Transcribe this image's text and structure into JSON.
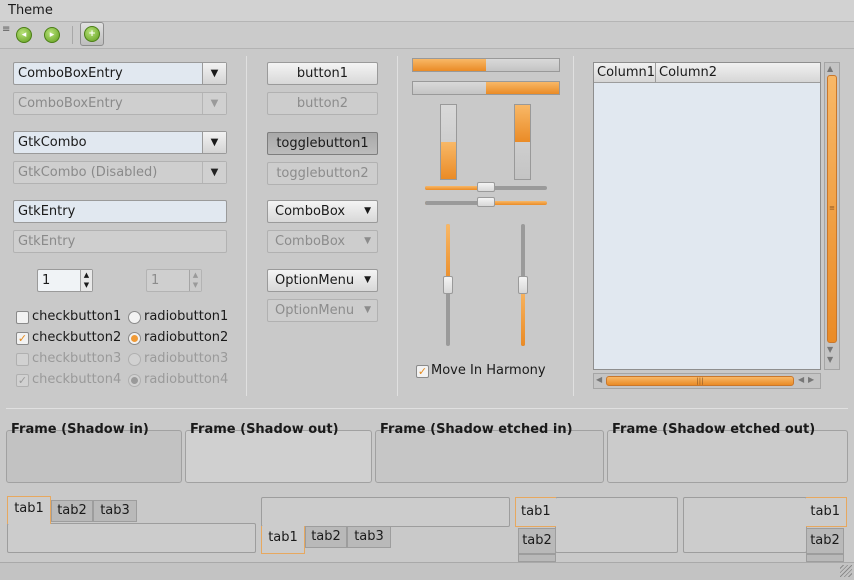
{
  "menubar": {
    "theme": "Theme"
  },
  "toolbar": {
    "first_icon": "go-first-icon",
    "last_icon": "go-last-icon",
    "add_icon": "add-icon"
  },
  "col1": {
    "combo_entry": "ComboBoxEntry",
    "combo_entry_disabled": "ComboBoxEntry",
    "gtk_combo": "GtkCombo",
    "gtk_combo_disabled": "GtkCombo (Disabled)",
    "entry": "GtkEntry",
    "entry_disabled_placeholder": "GtkEntry",
    "spin1": "1",
    "spin2": "1",
    "check1": "checkbutton1",
    "check2": "checkbutton2",
    "check3": "checkbutton3",
    "check4": "checkbutton4",
    "radio1": "radiobutton1",
    "radio2": "radiobutton2",
    "radio3": "radiobutton3",
    "radio4": "radiobutton4"
  },
  "col2": {
    "button1": "button1",
    "button2": "button2",
    "toggle1": "togglebutton1",
    "toggle2": "togglebutton2",
    "combobox": "ComboBox",
    "combobox_disabled": "ComboBox",
    "optionmenu": "OptionMenu",
    "optionmenu_disabled": "OptionMenu"
  },
  "col3": {
    "hbar1_fraction": 0.5,
    "hbar2_fraction": 0.5,
    "vbar1_fraction": 0.5,
    "vbar2_fraction": 0.5,
    "hscale1_value": 0.5,
    "hscale2_value": 0.5,
    "vscale1_value": 0.5,
    "vscale2_value": 0.5,
    "harmony": "Move In Harmony"
  },
  "tree": {
    "columns": [
      "Column1",
      "Column2"
    ]
  },
  "frames": {
    "shadow_in": "Frame (Shadow in)",
    "shadow_out": "Frame (Shadow out)",
    "etched_in": "Frame (Shadow etched in)",
    "etched_out": "Frame (Shadow etched out)"
  },
  "notebooks": {
    "nb1": [
      "tab1",
      "tab2",
      "tab3"
    ],
    "nb2": [
      "tab1",
      "tab2",
      "tab3"
    ],
    "nb3": [
      "tab1",
      "tab2"
    ],
    "nb4": [
      "tab1",
      "tab2"
    ]
  },
  "colors": {
    "accent": "#ef9431",
    "field": "#e1e8f0"
  }
}
